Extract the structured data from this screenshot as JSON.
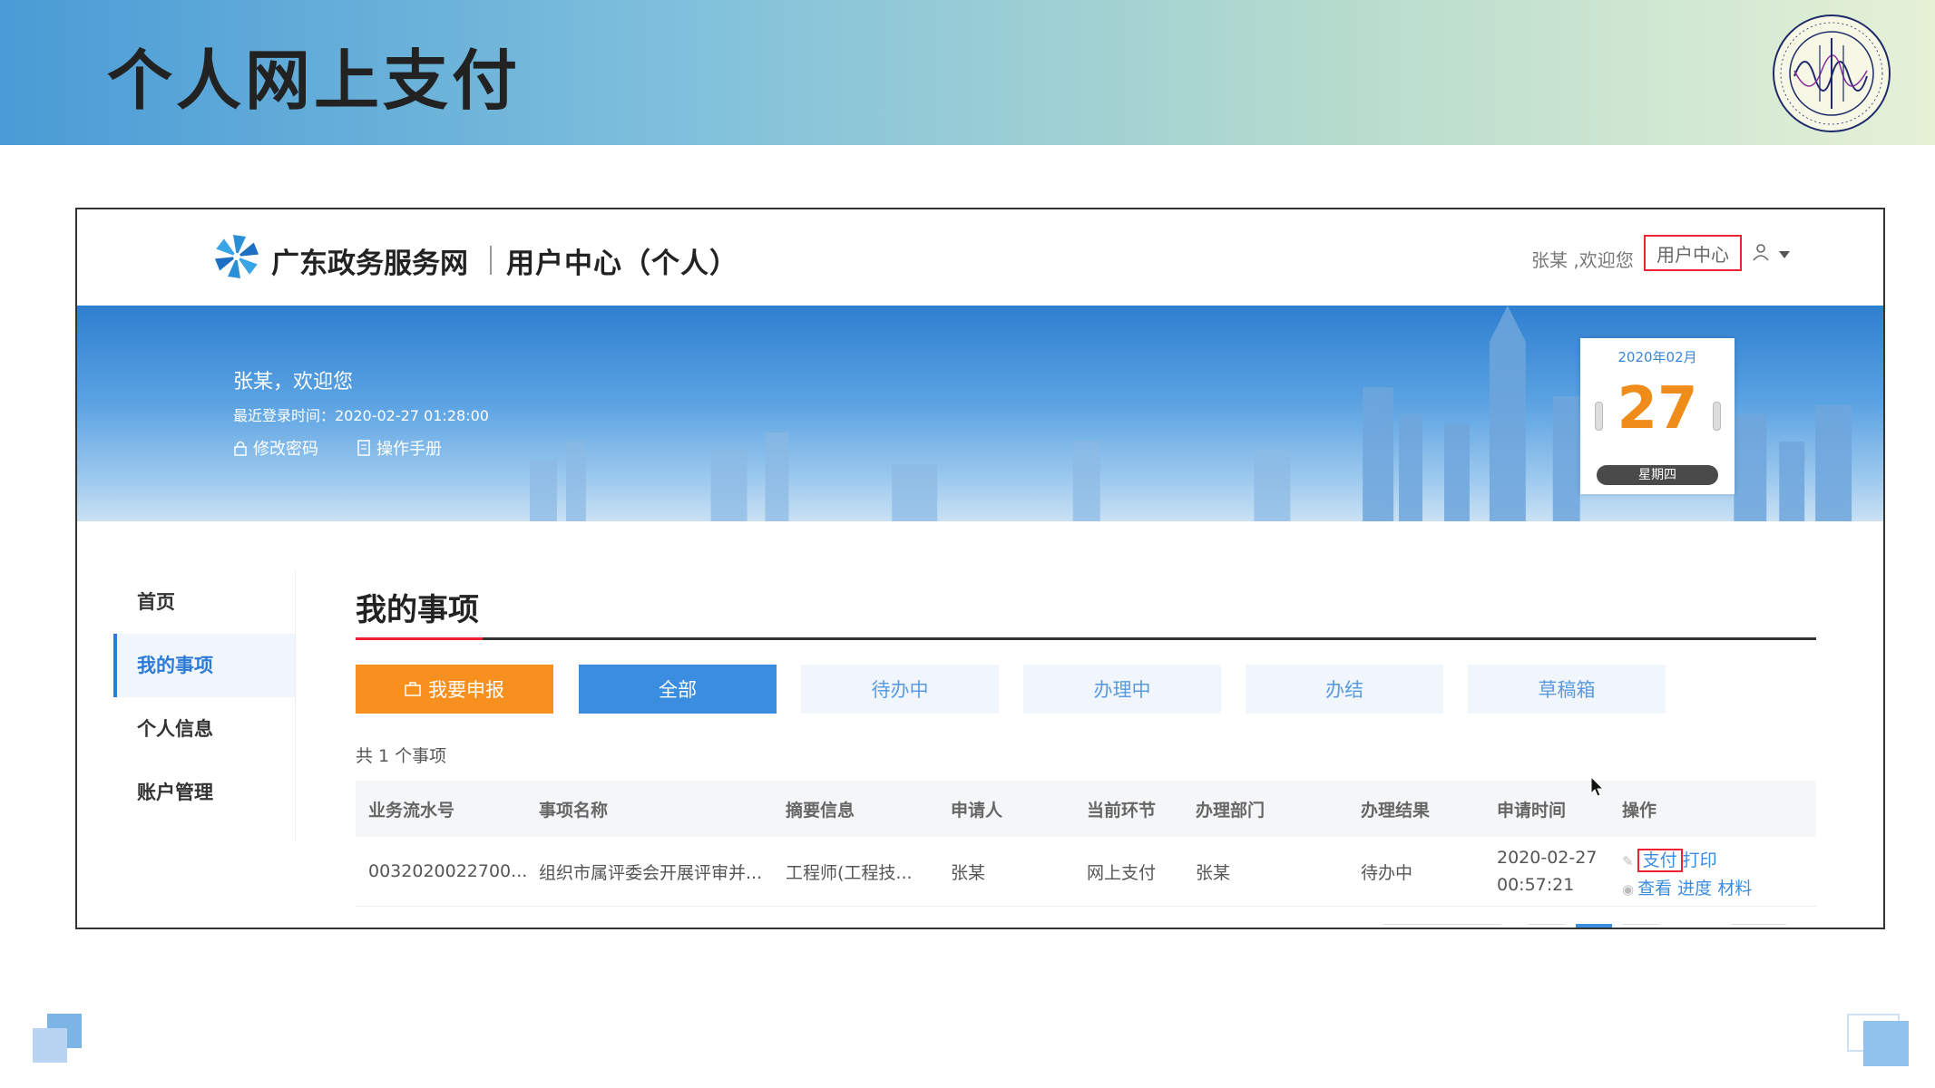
{
  "slide": {
    "title": "个人网上支付"
  },
  "header": {
    "site_name": "广东政务服务网",
    "center_name": "用户中心（个人）",
    "welcome": "张某 ,欢迎您",
    "user_center_label": "用户中心"
  },
  "banner": {
    "greeting": "张某，欢迎您",
    "last_login": "最近登录时间：2020-02-27 01:28:00",
    "change_password": "修改密码",
    "manual": "操作手册",
    "calendar": {
      "month": "2020年02月",
      "day": "27",
      "weekday": "星期四"
    }
  },
  "sidebar": {
    "items": [
      {
        "label": "首页"
      },
      {
        "label": "我的事项"
      },
      {
        "label": "个人信息"
      },
      {
        "label": "账户管理"
      }
    ],
    "active_index": 1
  },
  "main": {
    "title": "我的事项",
    "report_button": "我要申报",
    "tabs": [
      "全部",
      "待办中",
      "办理中",
      "办结",
      "草稿箱"
    ],
    "count_text": "共 1 个事项"
  },
  "table": {
    "columns": [
      "业务流水号",
      "事项名称",
      "摘要信息",
      "申请人",
      "当前环节",
      "办理部门",
      "办理结果",
      "申请时间",
      "操作"
    ],
    "rows": [
      {
        "serial": "0032020022700...",
        "item_name": "组织市属评委会开展评审并...",
        "summary": "工程师(工程技...",
        "applicant": "张某",
        "stage": "网上支付",
        "department": "张某",
        "result": "待办中",
        "date": "2020-02-27",
        "time": "00:57:21",
        "actions": {
          "pay": "支付",
          "print": "打印",
          "view": "查看",
          "progress": "进度",
          "materials": "材料"
        }
      }
    ]
  },
  "colors": {
    "accent_blue": "#3b8de0",
    "orange": "#f7901e",
    "highlight_red": "#e23"
  }
}
